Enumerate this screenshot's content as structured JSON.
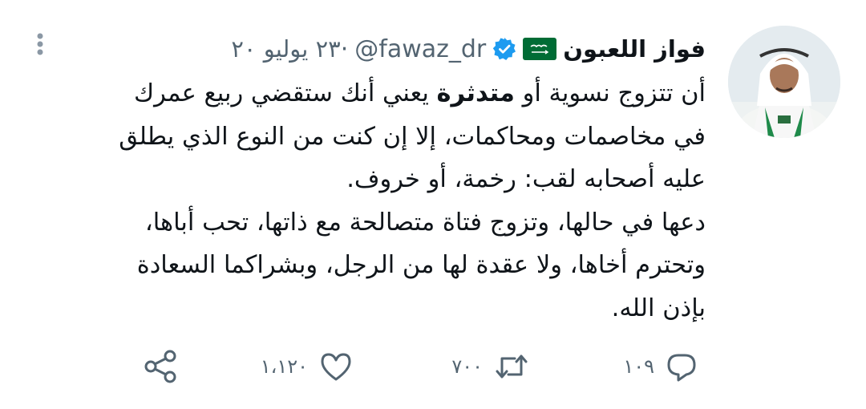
{
  "tweet": {
    "display_name": "فواز اللعبون",
    "handle": "@fawaz_dr",
    "separator": "·",
    "date": "٢٣ يوليو ٢٠",
    "text_line_1_before": "أن تتزوج نسوية أو ",
    "text_line_1_bold": "متدثرة",
    "text_line_1_after": " يعني أنك ستقضي ربيع عمرك",
    "text_line_2": "في مخاصمات ومحاكمات، إلا إن كنت من النوع الذي يطلق",
    "text_line_3": "عليه أصحابه لقب: رخمة، أو خروف.",
    "text_line_4": "دعها في حالها، وتزوج فتاة متصالحة مع ذاتها، تحب أباها،",
    "text_line_5": "وتحترم أخاها، ولا عقدة لها من الرجل، وبشراكما السعادة",
    "text_line_6": "بإذن الله."
  },
  "actions": {
    "reply_count": "١٠٩",
    "retweet_count": "٧٠٠",
    "like_count": "١،١٢٠"
  },
  "icons": {
    "avatar": "profile-photo",
    "flag": "saudi-flag-icon",
    "verified": "verified-badge-icon",
    "more": "more-vertical-icon",
    "reply": "reply-icon",
    "retweet": "retweet-icon",
    "like": "heart-icon",
    "share": "share-icon"
  },
  "colors": {
    "text": "#0f1419",
    "muted": "#536471",
    "verified": "#1d9bf0",
    "flag_green": "#006c35"
  }
}
